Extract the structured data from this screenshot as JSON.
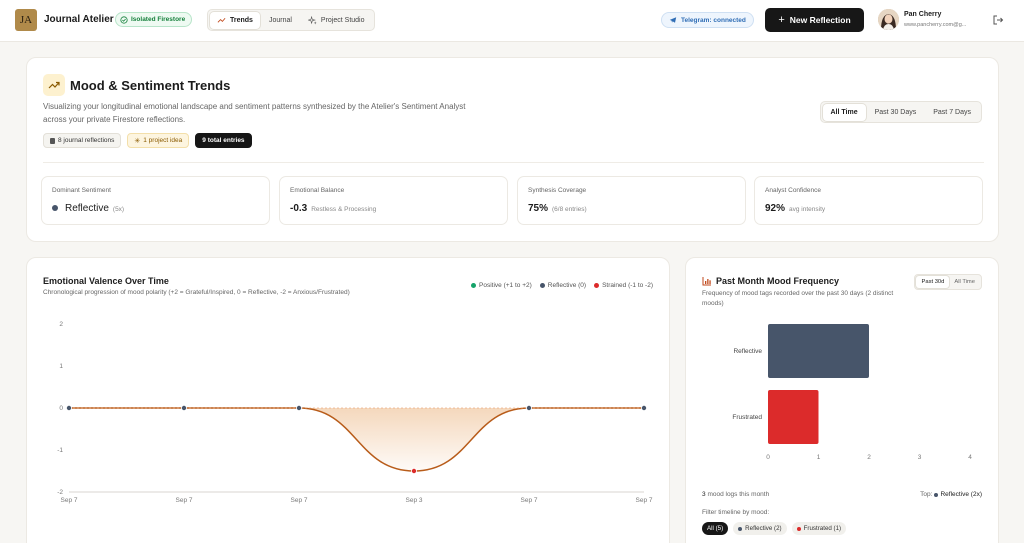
{
  "header": {
    "logo": "JA",
    "app_name": "Journal Atelier",
    "firestore_badge": "Isolated Firestore",
    "nav": [
      {
        "label": "Trends",
        "active": true
      },
      {
        "label": "Journal",
        "active": false
      },
      {
        "label": "Project Studio",
        "active": false
      }
    ],
    "telegram": "Telegram: connected",
    "new_button": "New Reflection",
    "user_name": "Pan Cherry",
    "user_email": "www.pancherry.com@g..."
  },
  "trends": {
    "title": "Mood & Sentiment Trends",
    "description": "Visualizing your longitudinal emotional landscape and sentiment patterns synthesized by the Atelier's Sentiment Analyst across your private Firestore reflections.",
    "chips": [
      "8 journal reflections",
      "1 project idea",
      "9 total entries"
    ],
    "ranges": [
      {
        "label": "All Time",
        "active": true
      },
      {
        "label": "Past 30 Days",
        "active": false
      },
      {
        "label": "Past 7 Days",
        "active": false
      }
    ],
    "stats": [
      {
        "label": "Dominant Sentiment",
        "value": "Reflective",
        "sub": "(5x)"
      },
      {
        "label": "Emotional Balance",
        "value": "-0.3",
        "sub": "Restless & Processing"
      },
      {
        "label": "Synthesis Coverage",
        "value": "75%",
        "sub": "(6/8 entries)"
      },
      {
        "label": "Analyst Confidence",
        "value": "92%",
        "sub": "avg intensity"
      }
    ]
  },
  "valence": {
    "title": "Emotional Valence Over Time",
    "subtitle": "Chronological progression of mood polarity (+2 = Grateful/Inspired, 0 = Reflective, -2 = Anxious/Frustrated)",
    "legend": [
      "Positive (+1 to +2)",
      "Reflective (0)",
      "Strained (-1 to -2)"
    ]
  },
  "frequency": {
    "title": "Past Month Mood Frequency",
    "subtitle": "Frequency of mood tags recorded over the past 30 days (2 distinct moods)",
    "toggle": [
      {
        "label": "Past 30d",
        "active": true
      },
      {
        "label": "All Time",
        "active": false
      }
    ],
    "footer_count": "3",
    "footer_text": "mood logs this month",
    "top_label": "Top:",
    "top_value": "Reflective (2x)",
    "filter_label": "Filter timeline by mood:",
    "filters": [
      "All (5)",
      "Reflective (2)",
      "Frustrated (1)"
    ]
  },
  "colors": {
    "reflective": "#47556a",
    "frustrated": "#dc2b2b",
    "positive": "#16a36a",
    "line": "#b85c1a"
  },
  "chart_data": [
    {
      "type": "area",
      "title": "Emotional Valence Over Time",
      "x": [
        "Sep 7",
        "Sep 7",
        "Sep 7",
        "Sep 3",
        "Sep 7",
        "Sep 7"
      ],
      "series": [
        {
          "values": [
            0,
            0,
            0,
            -1.5,
            0,
            0
          ]
        }
      ],
      "ylim": [
        -2,
        2
      ],
      "yticks": [
        2,
        1,
        0,
        -1,
        -2
      ],
      "legend": [
        "Positive (+1 to +2)",
        "Reflective (0)",
        "Strained (-1 to -2)"
      ],
      "legend_position": "top-right",
      "grid": false
    },
    {
      "type": "bar",
      "orientation": "horizontal",
      "title": "Past Month Mood Frequency",
      "categories": [
        "Reflective",
        "Frustrated"
      ],
      "values": [
        2,
        1
      ],
      "xlim": [
        0,
        4
      ],
      "xticks": [
        0,
        1,
        2,
        3,
        4
      ]
    }
  ]
}
